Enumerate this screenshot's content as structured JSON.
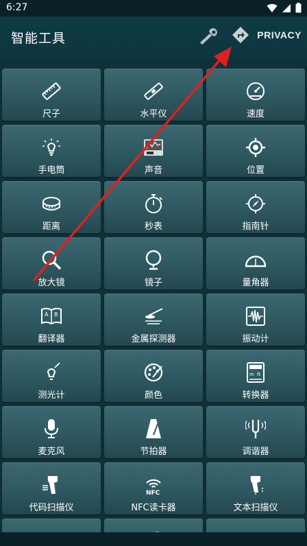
{
  "status": {
    "time": "6:27"
  },
  "app": {
    "title": "智能工具",
    "privacy": "PRIVACY"
  },
  "tools": [
    {
      "label": "尺子",
      "icon": "ruler-icon"
    },
    {
      "label": "水平仪",
      "icon": "level-icon"
    },
    {
      "label": "速度",
      "icon": "speedometer-icon"
    },
    {
      "label": "手电筒",
      "icon": "flashlight-icon"
    },
    {
      "label": "声音",
      "icon": "sound-meter-icon"
    },
    {
      "label": "位置",
      "icon": "location-icon"
    },
    {
      "label": "距离",
      "icon": "tape-measure-icon"
    },
    {
      "label": "秒表",
      "icon": "stopwatch-icon"
    },
    {
      "label": "指南针",
      "icon": "compass-icon"
    },
    {
      "label": "放大镜",
      "icon": "magnifier-icon"
    },
    {
      "label": "镜子",
      "icon": "mirror-icon"
    },
    {
      "label": "量角器",
      "icon": "protractor-icon"
    },
    {
      "label": "翻译器",
      "icon": "translate-book-icon"
    },
    {
      "label": "金属探测器",
      "icon": "metal-detector-icon"
    },
    {
      "label": "振动计",
      "icon": "vibration-icon"
    },
    {
      "label": "测光计",
      "icon": "light-meter-icon"
    },
    {
      "label": "颜色",
      "icon": "palette-icon"
    },
    {
      "label": "转换器",
      "icon": "calculator-icon"
    },
    {
      "label": "麦克风",
      "icon": "microphone-icon"
    },
    {
      "label": "节拍器",
      "icon": "metronome-icon"
    },
    {
      "label": "调谐器",
      "icon": "tuning-fork-icon"
    },
    {
      "label": "代码扫描仪",
      "icon": "barcode-scanner-icon"
    },
    {
      "label": "NFC读卡器",
      "icon": "nfc-icon"
    },
    {
      "label": "文本扫描仪",
      "icon": "text-scanner-icon"
    },
    {
      "label": "",
      "icon": "partial-icon"
    },
    {
      "label": "",
      "icon": "partial-icon"
    },
    {
      "label": "",
      "icon": "partial-icon"
    }
  ]
}
